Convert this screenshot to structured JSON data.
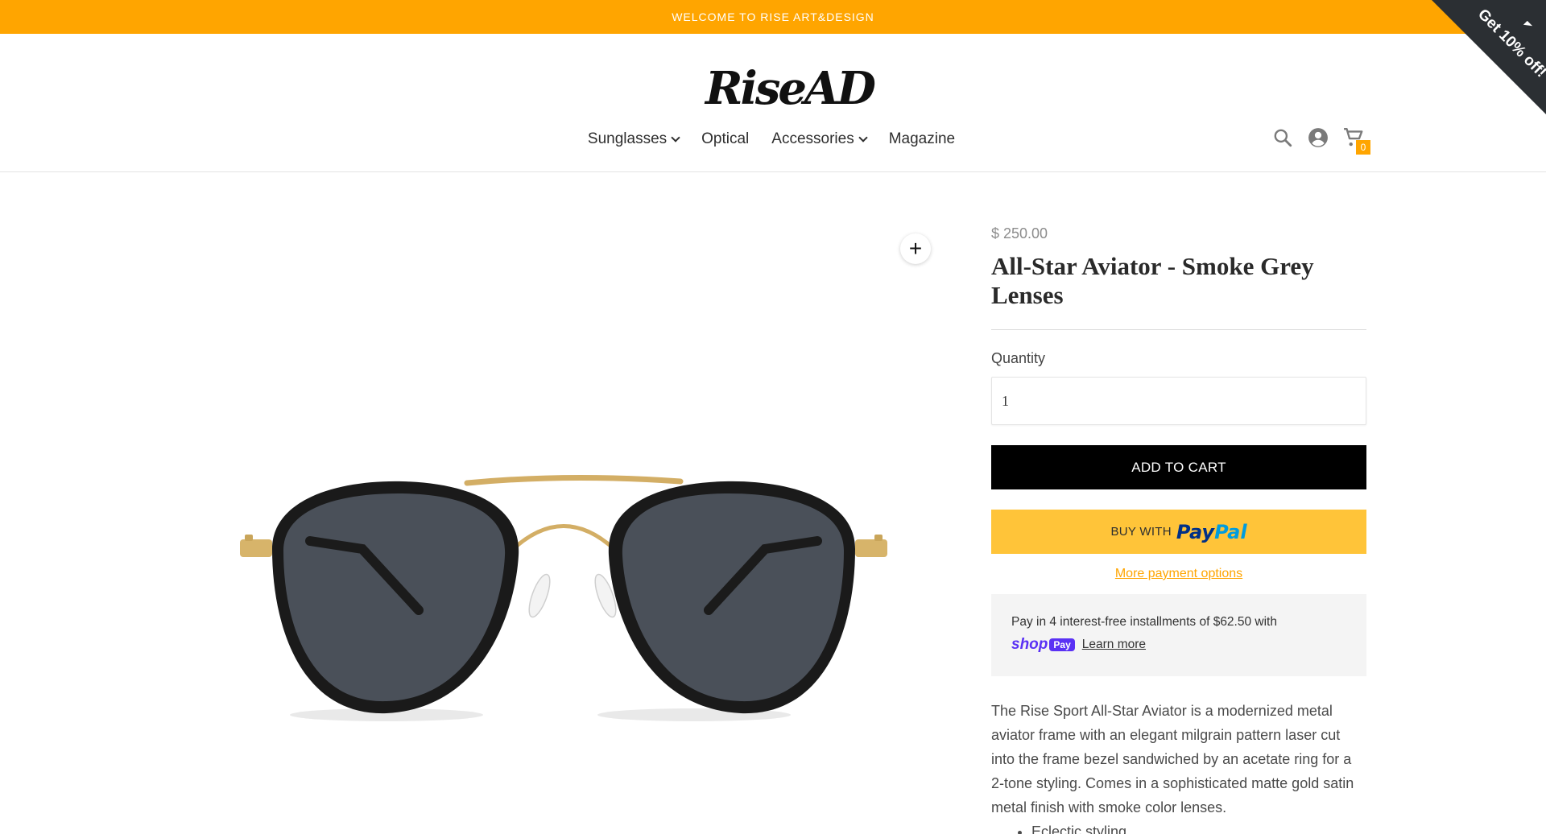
{
  "announcement": {
    "text": "WELCOME TO RISE ART&DESIGN"
  },
  "promo": {
    "label": "Get 10% off!"
  },
  "brand": {
    "logo_text": "RiseAD",
    "accent": "#ffa500"
  },
  "nav": {
    "items": [
      {
        "label": "Sunglasses",
        "has_dropdown": true
      },
      {
        "label": "Optical",
        "has_dropdown": false
      },
      {
        "label": "Accessories",
        "has_dropdown": true
      },
      {
        "label": "Magazine",
        "has_dropdown": false
      }
    ]
  },
  "header_icons": {
    "search": "search-icon",
    "account": "account-icon",
    "cart": "cart-icon",
    "cart_count": "0"
  },
  "product": {
    "price": "$ 250.00",
    "title": "All-Star Aviator - Smoke Grey Lenses",
    "quantity_label": "Quantity",
    "quantity_value": "1",
    "add_to_cart": "ADD TO CART",
    "paypal_prefix": "BUY WITH",
    "paypal_brand_a": "Pay",
    "paypal_brand_b": "Pal",
    "more_payment": "More payment options",
    "installments": "Pay in 4 interest-free installments of $62.50 with",
    "shop_pay_shop": "shop",
    "shop_pay_pay": "Pay",
    "learn_more": "Learn more",
    "description": "The Rise Sport All-Star Aviator is a modernized metal aviator frame with an elegant milgrain pattern laser cut into the frame bezel sandwiched by an acetate ring for a 2-tone styling. Comes in a sophisticated matte gold satin metal finish with smoke color lenses.",
    "features": [
      "Eclectic styling"
    ]
  }
}
